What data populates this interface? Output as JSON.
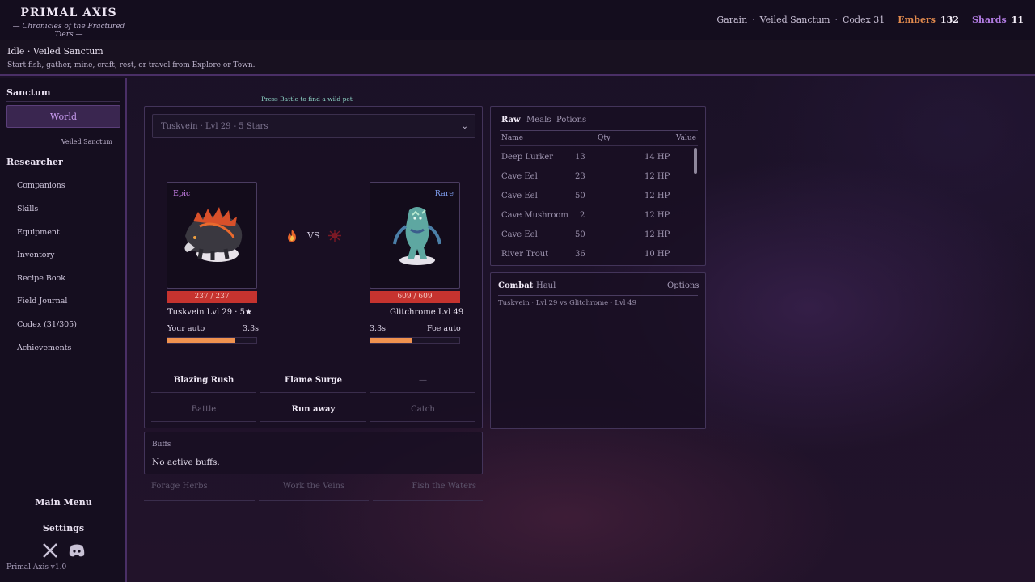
{
  "brand": {
    "title": "PRIMAL AXIS",
    "subtitle": "— Chronicles of the Fractured Tiers —"
  },
  "header": {
    "player": "Garain",
    "location": "Veiled Sanctum",
    "codex": "Codex 31",
    "embers_label": "Embers",
    "embers_value": "132",
    "shards_label": "Shards",
    "shards_value": "11"
  },
  "status": {
    "state": "Idle",
    "location": "Veiled Sanctum",
    "hint": "Start fish, gather, mine, craft, rest, or travel from Explore or Town."
  },
  "sidebar": {
    "section1": "Sanctum",
    "world_button": "World",
    "world_sub": "Veiled Sanctum",
    "section2": "Researcher",
    "items": [
      "Companions",
      "Skills",
      "Equipment",
      "Inventory",
      "Recipe Book",
      "Field Journal",
      "Codex (31/305)",
      "Achievements"
    ],
    "main_menu": "Main Menu",
    "settings": "Settings",
    "version": "Primal Axis  v1.0"
  },
  "battle": {
    "hint": "Press Battle to find a wild pet",
    "selected_pet": "Tuskvein · Lvl 29 - 5 Stars",
    "vs": "VS",
    "player_pet": {
      "rarity": "Epic",
      "hp": "237 / 237",
      "name": "Tuskvein Lvl 29 · 5★",
      "auto_label": "Your auto",
      "auto_time": "3.3s",
      "auto_progress": 0.76
    },
    "enemy_pet": {
      "rarity": "Rare",
      "hp": "609 / 609",
      "name": "Glitchrome Lvl 49",
      "auto_label": "Foe auto",
      "auto_time": "3.3s",
      "auto_progress": 0.47
    },
    "moves": [
      "Blazing Rush",
      "Flame Surge",
      "—"
    ],
    "actions": [
      "Battle",
      "Run away",
      "Catch"
    ]
  },
  "buffs": {
    "label": "Buffs",
    "text": "No active buffs."
  },
  "forage": [
    "Forage Herbs",
    "Work the Veins",
    "Fish the Waters"
  ],
  "inventory": {
    "tabs": [
      "Raw",
      "Meals",
      "Potions"
    ],
    "columns": [
      "Name",
      "Qty",
      "Value"
    ],
    "rows": [
      {
        "name": "Deep Lurker",
        "qty": "13",
        "value": "14 HP"
      },
      {
        "name": "Cave Eel",
        "qty": "23",
        "value": "12 HP"
      },
      {
        "name": "Cave Eel",
        "qty": "50",
        "value": "12 HP"
      },
      {
        "name": "Cave Mushroom",
        "qty": "2",
        "value": "12 HP"
      },
      {
        "name": "Cave Eel",
        "qty": "50",
        "value": "12 HP"
      },
      {
        "name": "River Trout",
        "qty": "36",
        "value": "10 HP"
      }
    ]
  },
  "log": {
    "tabs": [
      "Combat",
      "Haul"
    ],
    "options": "Options",
    "entry": "Tuskvein · Lvl 29 vs Glitchrome · Lvl 49"
  },
  "colors": {
    "accent": "#c89bef",
    "hp": "#c6332f",
    "auto": "#f0924f",
    "embers": "#e0894d",
    "shards": "#b07ae0"
  }
}
